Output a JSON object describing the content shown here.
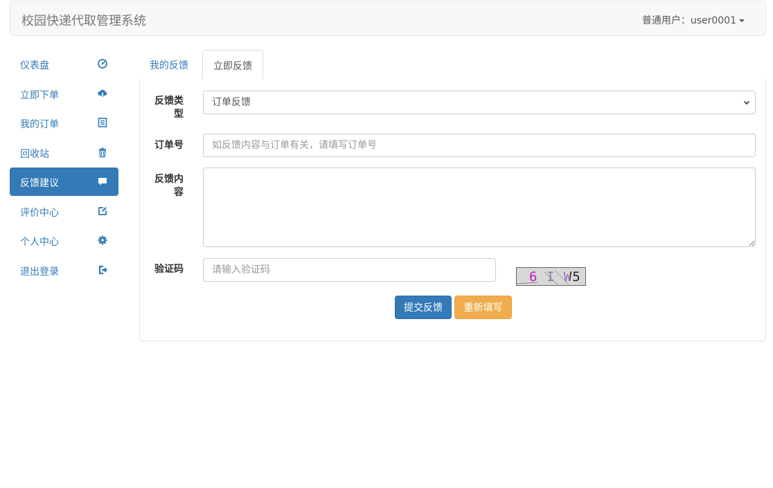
{
  "header": {
    "brand": "校园快递代取管理系统",
    "user_menu": "普通用户：user0001"
  },
  "sidebar": {
    "items": [
      {
        "label": "仪表盘",
        "icon": "dashboard-icon",
        "active": false
      },
      {
        "label": "立即下单",
        "icon": "cloud-download-icon",
        "active": false
      },
      {
        "label": "我的订单",
        "icon": "list-alt-icon",
        "active": false
      },
      {
        "label": "回收站",
        "icon": "trash-icon",
        "active": false
      },
      {
        "label": "反馈建议",
        "icon": "comment-icon",
        "active": true
      },
      {
        "label": "评价中心",
        "icon": "edit-icon",
        "active": false
      },
      {
        "label": "个人中心",
        "icon": "gear-icon",
        "active": false
      },
      {
        "label": "退出登录",
        "icon": "logout-icon",
        "active": false
      }
    ]
  },
  "tabs": [
    {
      "label": "我的反馈",
      "active": false
    },
    {
      "label": "立即反馈",
      "active": true
    }
  ],
  "form": {
    "type_label": "反馈类型",
    "type_value": "订单反馈",
    "order_label": "订单号",
    "order_placeholder": "如反馈内容与订单有关，请填写订单号",
    "content_label": "反馈内容",
    "content_value": "",
    "captcha_label": "验证码",
    "captcha_placeholder": "请输入验证码",
    "captcha_text": "6 I W5",
    "submit_label": "提交反馈",
    "reset_label": "重新填写"
  },
  "colors": {
    "primary": "#337ab7",
    "warning": "#f0ad4e",
    "navbar_bg": "#f8f8f8"
  }
}
